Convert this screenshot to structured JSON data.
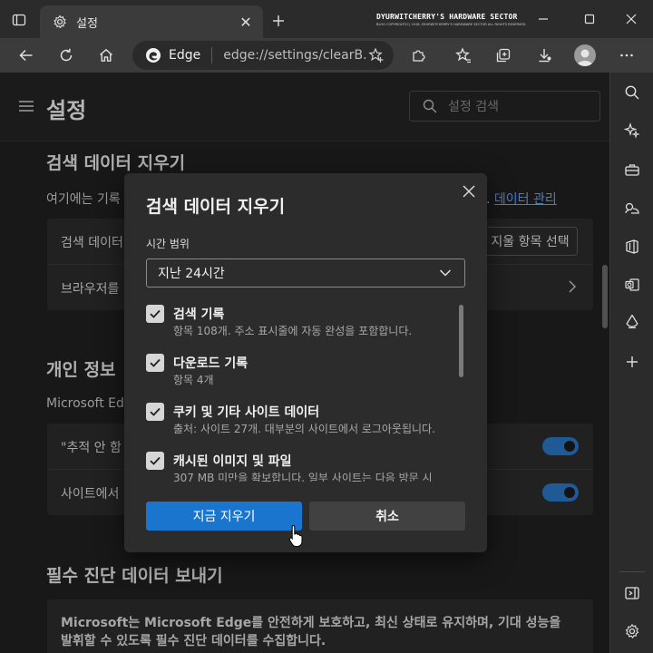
{
  "window": {
    "tab_title": "설정",
    "watermark_line1": "DYURWITCHERRY'S HARDWARE SECTOR",
    "watermark_line2": "BLOG COPYRIGHT(C) 2018, DYURWITCHERRY'S HARDWARE SECTOR ALL RIGHTS RESERVED."
  },
  "addressbar": {
    "site_name": "Edge",
    "url": "edge://settings/clearB..."
  },
  "settings": {
    "title": "설정",
    "search_placeholder": "설정 검색"
  },
  "sections": {
    "clear_data": {
      "title": "검색 데이터 지우기",
      "desc_start": "여기에는 기록",
      "desc_end": ". ",
      "manage_link": "데이터 관리",
      "row1_label": "검색 데이터",
      "row1_button": "지울 항목 선택",
      "row2_label": "브라우저를"
    },
    "privacy": {
      "title": "개인 정보",
      "desc": "Microsoft Edge",
      "row1_label": "\"추적 안 함",
      "row2_label": "사이트에서"
    },
    "diagnostics": {
      "title": "필수 진단 데이터 보내기",
      "body_line1": "Microsoft는 Microsoft Edge를 안전하게 보호하고, 최신 상태로 유지하며, 기대 성능을",
      "body_line2": "발휘할 수 있도록 필수 진단 데이터를 수집합니다."
    }
  },
  "dialog": {
    "title": "검색 데이터 지우기",
    "time_range_label": "시간 범위",
    "time_range_value": "지난 24시간",
    "items": [
      {
        "title": "검색 기록",
        "subtitle": "항목 108개. 주소 표시줄에 자동 완성을 포함합니다.",
        "checked": true
      },
      {
        "title": "다운로드 기록",
        "subtitle": "항목 4개",
        "checked": true
      },
      {
        "title": "쿠키 및 기타 사이트 데이터",
        "subtitle": "출처: 사이트 27개. 대부분의 사이트에서 로그아웃됩니다.",
        "checked": true
      },
      {
        "title": "캐시된 이미지 및 파일",
        "subtitle": "307 MB 미만을 확보합니다. 일부 사이트는 다음 방문 시",
        "checked": true
      }
    ],
    "clear_button": "지금 지우기",
    "cancel_button": "취소"
  },
  "colors": {
    "accent": "#1a75cf",
    "link": "#64a8ff",
    "toggle_on": "#2a78c8"
  },
  "icons": {
    "toolbar": [
      "back-arrow-icon",
      "refresh-icon",
      "home-icon",
      "favorites-star-icon",
      "extensions-icon",
      "favorites-icon",
      "collections-icon",
      "downloads-icon",
      "more-icon"
    ],
    "sidebar": [
      "search-icon",
      "discover-icon",
      "shopping-icon",
      "games-icon",
      "office-icon",
      "outlook-icon",
      "drop-icon",
      "add-icon",
      "hide-sidebar-icon",
      "sidebar-settings-icon"
    ]
  }
}
